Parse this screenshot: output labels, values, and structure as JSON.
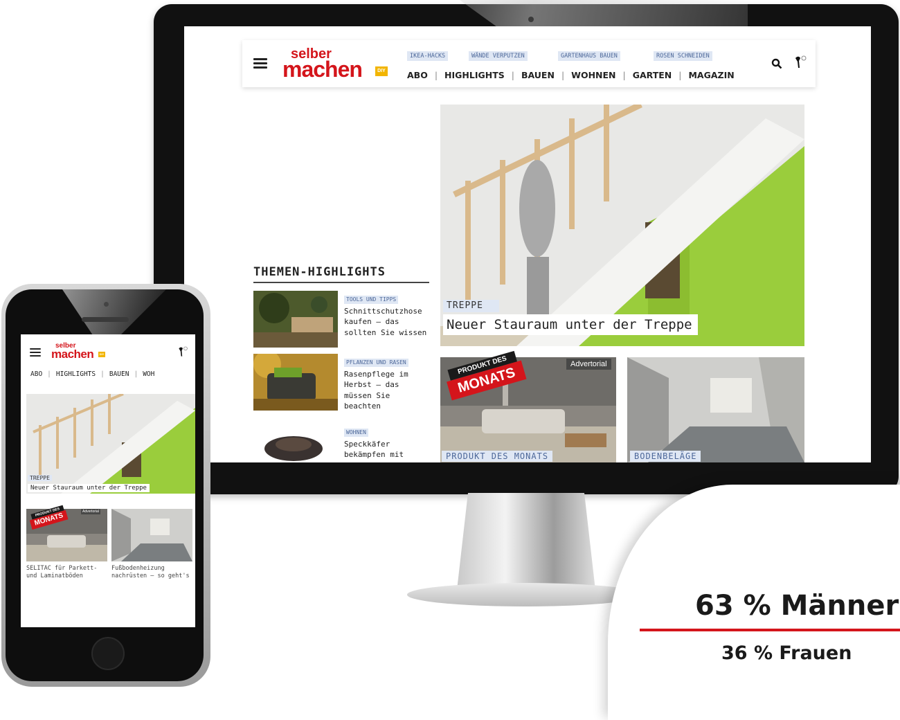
{
  "colors": {
    "brand": "#d4151b",
    "tag_bg": "#dfe7f4",
    "tag_text": "#4c6799",
    "diy": "#f2b500"
  },
  "logo": {
    "top": "selber",
    "bottom": "machen",
    "diy": "DIY"
  },
  "desktop": {
    "tags": [
      "IKEA-HACKS",
      "WÄNDE VERPUTZEN",
      "GARTENHAUS BAUEN",
      "ROSEN SCHNEIDEN"
    ],
    "nav": [
      "ABO",
      "HIGHLIGHTS",
      "BAUEN",
      "WOHNEN",
      "GARTEN",
      "MAGAZIN"
    ],
    "hero": {
      "category": "TREPPE",
      "title": "Neuer Stauraum unter der Treppe"
    },
    "themen": {
      "title": "THEMEN-HIGHLIGHTS",
      "items": [
        {
          "category": "TOOLS UND TIPPS",
          "text": "Schnittschutzhose kaufen – das sollten Sie wissen"
        },
        {
          "category": "PFLANZEN UND RASEN",
          "text": "Rasenpflege im Herbst – das müssen Sie beachten"
        },
        {
          "category": "WOHNEN",
          "text": "Speckkäfer bekämpfen mit"
        }
      ]
    },
    "cards": [
      {
        "category": "PRODUKT DES MONATS",
        "badge": "Advertorial",
        "stamp_top": "PRODUKT DES",
        "stamp_bottom": "MONATS"
      },
      {
        "category": "BODENBELÄGE"
      }
    ]
  },
  "mobile": {
    "nav": [
      "ABO",
      "HIGHLIGHTS",
      "BAUEN",
      "WOH"
    ],
    "hero": {
      "category": "TREPPE",
      "title": "Neuer Stauraum unter der Treppe"
    },
    "cards": [
      {
        "text": "SELITAC für Parkett- und Laminatböden"
      },
      {
        "text": "Fußbodenheizung nachrüsten – so geht's"
      }
    ]
  },
  "stats": {
    "primary": "63 % Männer",
    "secondary": "36 % Frauen"
  },
  "icons": [
    "menu-icon",
    "search-icon",
    "user-icon"
  ]
}
